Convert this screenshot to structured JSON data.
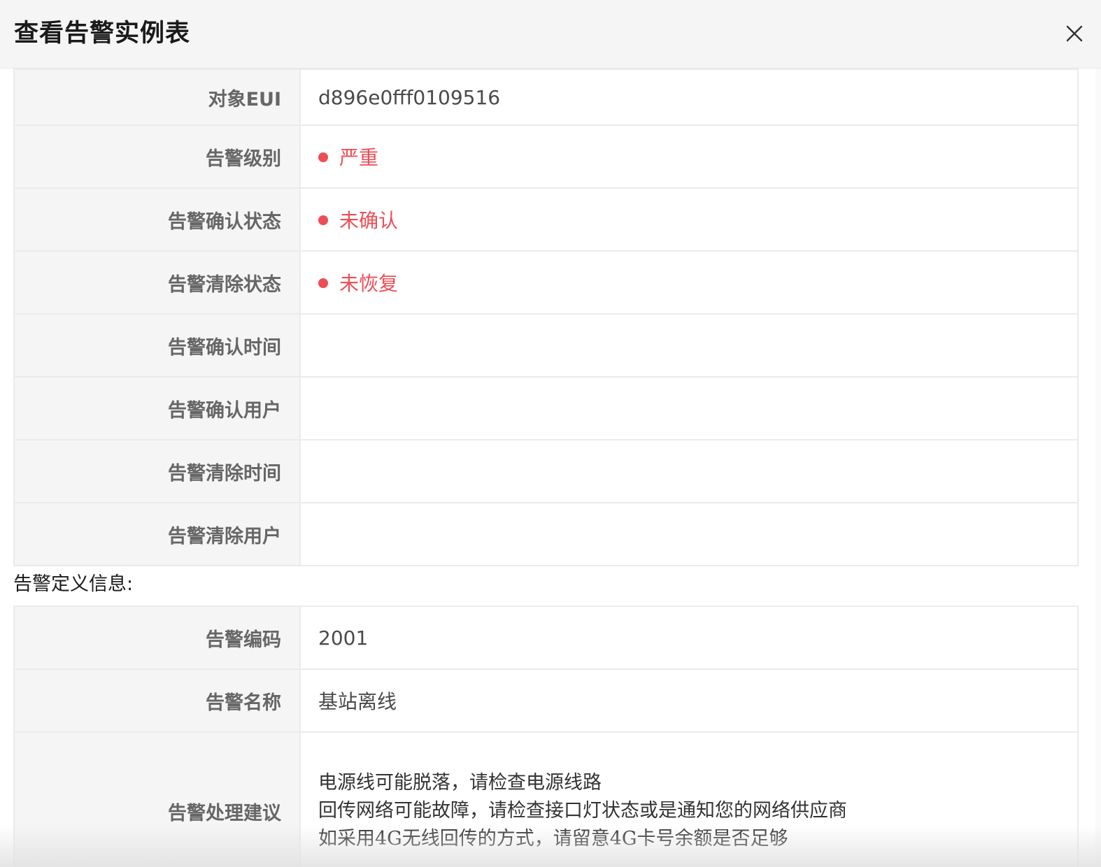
{
  "dialog": {
    "title": "查看告警实例表"
  },
  "instance_rows": [
    {
      "label": "对象EUI",
      "value": "d896e0fff0109516",
      "status": false
    },
    {
      "label": "告警级别",
      "value": "严重",
      "status": true
    },
    {
      "label": "告警确认状态",
      "value": "未确认",
      "status": true
    },
    {
      "label": "告警清除状态",
      "value": "未恢复",
      "status": true
    },
    {
      "label": "告警确认时间",
      "value": "",
      "status": false
    },
    {
      "label": "告警确认用户",
      "value": "",
      "status": false
    },
    {
      "label": "告警清除时间",
      "value": "",
      "status": false
    },
    {
      "label": "告警清除用户",
      "value": "",
      "status": false
    }
  ],
  "definition": {
    "section_title": "告警定义信息:",
    "rows": [
      {
        "label": "告警编码",
        "value": "2001"
      },
      {
        "label": "告警名称",
        "value": "基站离线"
      }
    ],
    "advice": {
      "label": "告警处理建议",
      "lines": [
        "电源线可能脱落，请检查电源线路",
        "回传网络可能故障，请检查接口灯状态或是通知您的网络供应商",
        "如采用4G无线回传的方式，请留意4G卡号余额是否足够"
      ]
    }
  },
  "colors": {
    "status_red": "#ee4d55",
    "label_bg": "#f5f5f5",
    "border": "#ebebeb"
  },
  "icons": {
    "close": "close-icon",
    "status": "status-dot-icon"
  }
}
